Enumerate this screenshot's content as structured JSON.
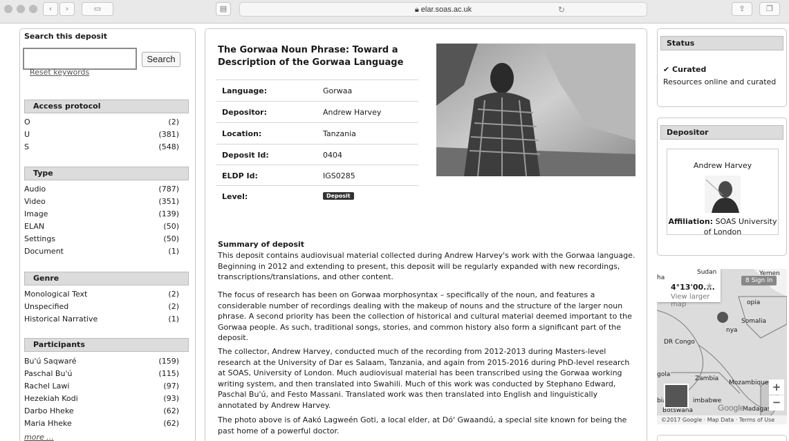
{
  "browser": {
    "url": "elar.soas.ac.uk"
  },
  "search": {
    "title": "Search this deposit",
    "placeholder": "",
    "value": "",
    "button": "Search",
    "reset": "Reset keywords"
  },
  "facets": [
    {
      "heading": "Access protocol",
      "items": [
        {
          "label": "O",
          "count": "(2)"
        },
        {
          "label": "U",
          "count": "(381)"
        },
        {
          "label": "S",
          "count": "(548)"
        }
      ]
    },
    {
      "heading": "Type",
      "items": [
        {
          "label": "Audio",
          "count": "(787)"
        },
        {
          "label": "Video",
          "count": "(351)"
        },
        {
          "label": "Image",
          "count": "(139)"
        },
        {
          "label": "ELAN",
          "count": "(50)"
        },
        {
          "label": "Settings",
          "count": "(50)"
        },
        {
          "label": "Document",
          "count": "(1)"
        }
      ]
    },
    {
      "heading": "Genre",
      "items": [
        {
          "label": "Monological Text",
          "count": "(2)"
        },
        {
          "label": "Unspecified",
          "count": "(2)"
        },
        {
          "label": "Historical Narrative",
          "count": "(1)"
        }
      ]
    },
    {
      "heading": "Participants",
      "items": [
        {
          "label": "Bu'ú Saqwaré",
          "count": "(159)"
        },
        {
          "label": "Paschal Bu'ú",
          "count": "(115)"
        },
        {
          "label": "Rachel Lawi",
          "count": "(97)"
        },
        {
          "label": "Hezekiah Kodi",
          "count": "(93)"
        },
        {
          "label": "Darbo Hheke",
          "count": "(62)"
        },
        {
          "label": "Maria Hheke",
          "count": "(62)"
        }
      ],
      "more": "more ..."
    }
  ],
  "deposit": {
    "title": "The Gorwaa Noun Phrase: Toward a Description of the Gorwaa Language",
    "meta": [
      {
        "key": "Language:",
        "value": "Gorwaa"
      },
      {
        "key": "Depositor:",
        "value": "Andrew Harvey"
      },
      {
        "key": "Location:",
        "value": "Tanzania"
      },
      {
        "key": "Deposit Id:",
        "value": "0404"
      },
      {
        "key": "ELDP Id:",
        "value": "IGS0285"
      },
      {
        "key": "Level:",
        "value": "Deposit"
      }
    ],
    "summary_heading": "Summary of deposit",
    "paragraphs": [
      "This deposit contains audiovisual material collected during Andrew Harvey's work with the Gorwaa language. Beginning in 2012 and extending to present, this deposit will be regularly expanded with new recordings, transcriptions/translations, and other content.",
      "The focus of research has been on Gorwaa morphosyntax – specifically of the noun, and features a considerable number of recordings dealing with the makeup of nouns and the structure of the larger noun phrase. A second priority has been the collection of historical and cultural material deemed important to the Gorwaa people. As such, traditional songs, stories, and common history also form a significant part of the deposit.",
      "The collector, Andrew Harvey, conducted much of the recording from 2012-2013 during Masters-level research at the University of Dar es Salaam, Tanzania, and again from 2015-2016 during PhD-level research at SOAS, University of London. Much audiovisual material has been transcribed using the Gorwaa working writing system, and then translated into Swahili. Much of this work was conducted by Stephano Edward, Paschal Bu'ú, and Festo Massani. Translated work was then translated into English and linguistically annotated by Andrew Harvey.",
      "The photo above is of Aakó Lagweén Goti, a local elder, at Dó' Gwaandú, a special site known for being the past home of a powerful doctor."
    ]
  },
  "status": {
    "heading": "Status",
    "value": "Curated",
    "description": "Resources online and curated"
  },
  "depositor": {
    "heading": "Depositor",
    "name": "Andrew Harvey",
    "affiliation_label": "Affiliation:",
    "affiliation_value": "SOAS University of London"
  },
  "map": {
    "coord": "4°13'00....",
    "larger": "View larger map",
    "sign_in": "Sign in",
    "labels": [
      "Sudan",
      "Yemen",
      "Somalia",
      "DR Congo",
      "nya",
      "opia",
      "Zambia",
      "Mozambique",
      "imbabwe",
      "Botswana",
      "Madagascar",
      "gola",
      "ha",
      "bia"
    ],
    "footer": "©2017 Google · Map Data · Terms of Use",
    "logo": "Google"
  },
  "colors": {
    "header_bg": "#dcdcdc",
    "badge": "#333333"
  }
}
